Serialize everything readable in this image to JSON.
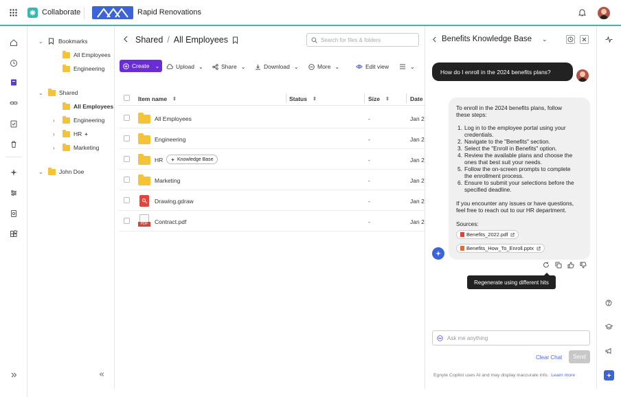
{
  "topbar": {
    "brand": "Collaborate",
    "product": "Rapid Renovations"
  },
  "tree": {
    "bookmarks": "Bookmarks",
    "bookmark_items": [
      "All Employees",
      "Engineering"
    ],
    "shared": "Shared",
    "shared_items": [
      "All Employees",
      "Engineering",
      "HR",
      "Marketing"
    ],
    "john": "John Doe"
  },
  "main": {
    "breadcrumb": {
      "root": "Shared",
      "sep": "/",
      "current": "All Employees"
    },
    "search_placeholder": "Search for files & folders",
    "toolbar": {
      "create": "Create",
      "upload": "Upload",
      "share": "Share",
      "download": "Download",
      "more": "More",
      "edit_view": "Edit view"
    },
    "columns": {
      "name": "Item name",
      "status": "Status",
      "size": "Size",
      "date": "Date"
    },
    "rows": [
      {
        "name": "All Employees",
        "size": "-",
        "date": "Jan 2"
      },
      {
        "name": "Engineering",
        "size": "-",
        "date": "Jan 2"
      },
      {
        "name": "HR",
        "badge": "Knowledge Base",
        "size": "-",
        "date": "Jan 2"
      },
      {
        "name": "Marketing",
        "size": "-",
        "date": "Jan 2"
      },
      {
        "name": "Drawing.gdraw",
        "size": "-",
        "date": "Jan 2"
      },
      {
        "name": "Contract.pdf",
        "size": "-",
        "date": "Jan 2",
        "file_tag": "PDF"
      }
    ]
  },
  "panel": {
    "title": "Benefits Knowledge Base",
    "user_question": "How do I enroll in the 2024 benefits plans?",
    "answer_intro_1": "To enroll in the 2024 benefits plans, follow",
    "answer_intro_2": "these steps:",
    "steps": [
      [
        "1.",
        "Log in to the employee portal using your",
        "credentials."
      ],
      [
        "2.",
        "Navigate to the \"Benefits\" section.",
        ""
      ],
      [
        "3.",
        "Select the \"Enroll in Benefits\" option.",
        ""
      ],
      [
        "4.",
        "Review the available plans and choose the",
        "ones that best suit your needs."
      ],
      [
        "5.",
        "Follow the on-screen prompts to complete",
        "the enrollment process."
      ],
      [
        "6.",
        "Ensure to submit your selections before the",
        "specified deadline."
      ]
    ],
    "outro_1": "If you encounter any issues or have questions,",
    "outro_2": "feel free to reach out to our HR department.",
    "sources_label": "Sources:",
    "sources": [
      "Benefits_2022.pdf",
      "Benefits_How_To_Enroll.pptx"
    ],
    "tooltip": "Regenerate using different hits",
    "input_placeholder": "Ask me anything",
    "clear_chat": "Clear Chat",
    "send": "Send",
    "disclaimer": "Egnyte Copilot uses AI and may display inaccurate info.",
    "learn_more": "Learn more"
  },
  "colors": {
    "accent": "#35b8b0",
    "create": "#6a2bd8",
    "link": "#5468c8",
    "logo_blue": "#3a64d8"
  }
}
